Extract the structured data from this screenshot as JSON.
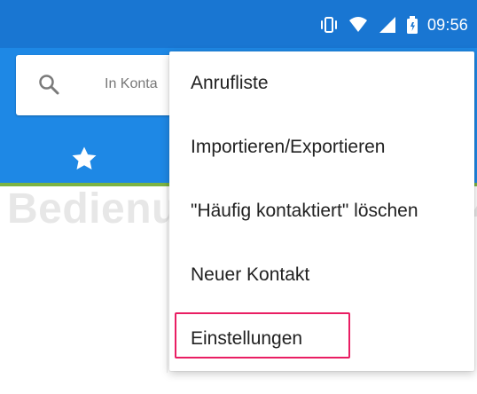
{
  "status_bar": {
    "time": "09:56",
    "icons": [
      "vibrate-icon",
      "wifi-icon",
      "signal-icon",
      "battery-icon"
    ]
  },
  "search": {
    "placeholder_visible": "In Konta"
  },
  "tabs": [
    {
      "icon": "star-icon"
    }
  ],
  "menu": {
    "items": [
      {
        "label": "Anrufliste"
      },
      {
        "label": "Importieren/Exportieren"
      },
      {
        "label": "\"Häufig kontaktiert\" löschen"
      },
      {
        "label": "Neuer Kontakt"
      },
      {
        "label": "Einstellungen",
        "highlighted": true
      }
    ]
  },
  "watermark": {
    "text": "Bedienungsanleitung24.de"
  },
  "colors": {
    "status_bar": "#1976d2",
    "app_bar": "#1e88e5",
    "highlight": "#e91e63",
    "tab_indicator": "#7cb342"
  }
}
